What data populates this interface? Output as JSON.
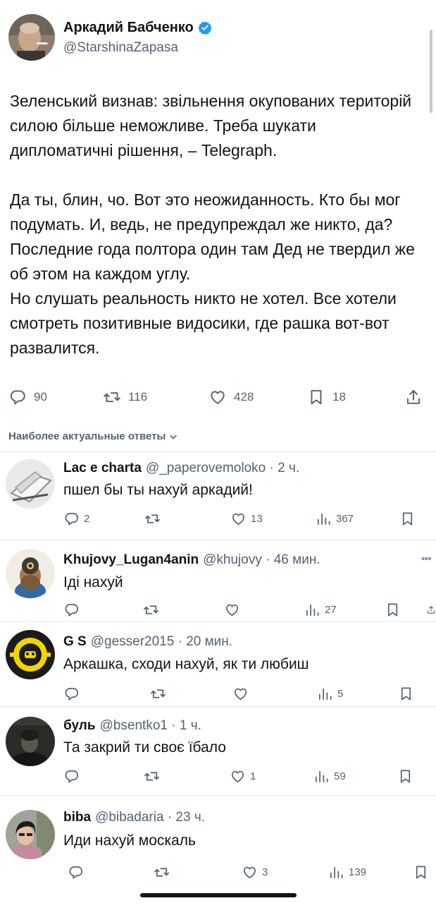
{
  "post": {
    "author_name": "Аркадий Бабченко",
    "author_handle": "@StarshinaZapasa",
    "paragraphs": [
      "Зеленський визнав: звільнення окупованих територій силою більше неможливе. Треба шукати дипломатичні рішення, – Telegraph.",
      "Да ты, блин, чо. Вот это неожиданность. Кто бы мог подумать. И, ведь, не предупреждал же никто, да?\nПоследние года полтора один там Дед не твердил же об этом на каждом углу.\nНо слушать реальность никто не хотел. Все хотели смотреть позитивные видосики, где рашка вот-вот развалится."
    ],
    "replies_count": "90",
    "reposts_count": "116",
    "likes_count": "428",
    "bookmarks_count": "18"
  },
  "sort_label": "Наиболее актуальные ответы",
  "replies": [
    {
      "name": "Lac e charta",
      "handle": "@_paperovemoloko · 2 ч.",
      "text": "пшел бы ты нахуй аркадий!",
      "reply_count": "2",
      "repost_count": "",
      "like_count": "13",
      "views": "367"
    },
    {
      "name": "Khujovy_Lugan4anin",
      "handle": "@khujovy · 46 мин.",
      "text": "Іді нахуй",
      "reply_count": "",
      "repost_count": "",
      "like_count": "",
      "views": "27"
    },
    {
      "name": "G S",
      "handle": "@gesser2015 · 20 мин.",
      "text": "Аркашка, сходи нахуй, як ти любиш",
      "reply_count": "",
      "repost_count": "",
      "like_count": "",
      "views": "5"
    },
    {
      "name": "буль",
      "handle": "@bsentko1 · 1 ч.",
      "text": "Та закрий ти своє їбало",
      "reply_count": "",
      "repost_count": "",
      "like_count": "1",
      "views": "59"
    },
    {
      "name": "biba",
      "handle": "@bibadaria · 23 ч.",
      "text": "Иди нахуй москаль",
      "reply_count": "",
      "repost_count": "",
      "like_count": "3",
      "views": "139"
    }
  ],
  "colors": {
    "text": "#0f1419",
    "secondary": "#536471",
    "verified": "#1d9bf0",
    "divider": "#e6e9eb"
  },
  "icons": [
    "reply-icon",
    "repost-icon",
    "like-icon",
    "bookmark-icon",
    "share-icon",
    "views-icon",
    "verified-badge-icon",
    "chevron-down-icon",
    "more-icon"
  ]
}
